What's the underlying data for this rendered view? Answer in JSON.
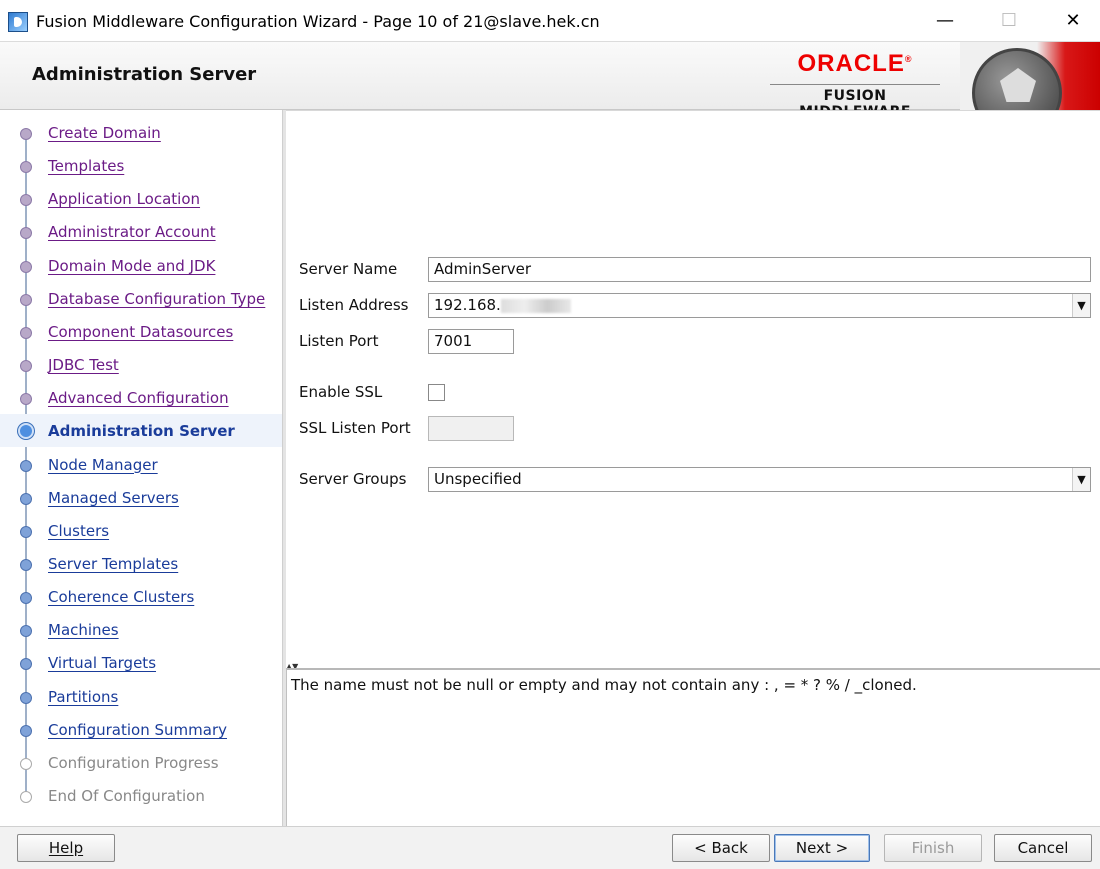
{
  "window": {
    "title": "Fusion Middleware Configuration Wizard - Page 10 of 21@slave.hek.cn",
    "minimize_icon": "—",
    "maximize_icon": "☐",
    "close_icon": "✕"
  },
  "header": {
    "page_title": "Administration Server",
    "brand_name": "ORACLE",
    "brand_mark": "®",
    "brand_sub": "FUSION MIDDLEWARE"
  },
  "nav": {
    "items": [
      {
        "label": "Create Domain",
        "state": "done"
      },
      {
        "label": "Templates",
        "state": "done"
      },
      {
        "label": "Application Location",
        "state": "done"
      },
      {
        "label": "Administrator Account",
        "state": "done"
      },
      {
        "label": "Domain Mode and JDK",
        "state": "done"
      },
      {
        "label": "Database Configuration Type",
        "state": "done"
      },
      {
        "label": "Component Datasources",
        "state": "done"
      },
      {
        "label": "JDBC Test",
        "state": "done"
      },
      {
        "label": "Advanced Configuration",
        "state": "done"
      },
      {
        "label": "Administration Server",
        "state": "current"
      },
      {
        "label": "Node Manager",
        "state": "todo"
      },
      {
        "label": "Managed Servers",
        "state": "todo"
      },
      {
        "label": "Clusters",
        "state": "todo"
      },
      {
        "label": "Server Templates",
        "state": "todo"
      },
      {
        "label": "Coherence Clusters",
        "state": "todo"
      },
      {
        "label": "Machines",
        "state": "todo"
      },
      {
        "label": "Virtual Targets",
        "state": "todo"
      },
      {
        "label": "Partitions",
        "state": "todo"
      },
      {
        "label": "Configuration Summary",
        "state": "todo"
      },
      {
        "label": "Configuration Progress",
        "state": "disabled"
      },
      {
        "label": "End Of Configuration",
        "state": "disabled"
      }
    ]
  },
  "form": {
    "server_name_label": "Server Name",
    "server_name_value": "AdminServer",
    "listen_address_label": "Listen Address",
    "listen_address_value": "192.168.",
    "listen_port_label": "Listen Port",
    "listen_port_value": "7001",
    "enable_ssl_label": "Enable SSL",
    "enable_ssl_checked": false,
    "ssl_listen_port_label": "SSL Listen Port",
    "ssl_listen_port_value": "",
    "server_groups_label": "Server Groups",
    "server_groups_value": "Unspecified",
    "dropdown_icon": "▼"
  },
  "message": {
    "split_grip": "▲▼",
    "text": "The name must not be null or empty and may not contain any : , = * ? % / _cloned."
  },
  "buttons": {
    "help": "Help",
    "back": "< Back",
    "next": "Next >",
    "finish": "Finish",
    "cancel": "Cancel"
  },
  "colors": {
    "brand_red": "#e00000",
    "nav_done": "#6b1b86",
    "nav_todo": "#1a3c9a",
    "nav_disabled": "#888888",
    "primary_button_border": "#4a78b8"
  }
}
